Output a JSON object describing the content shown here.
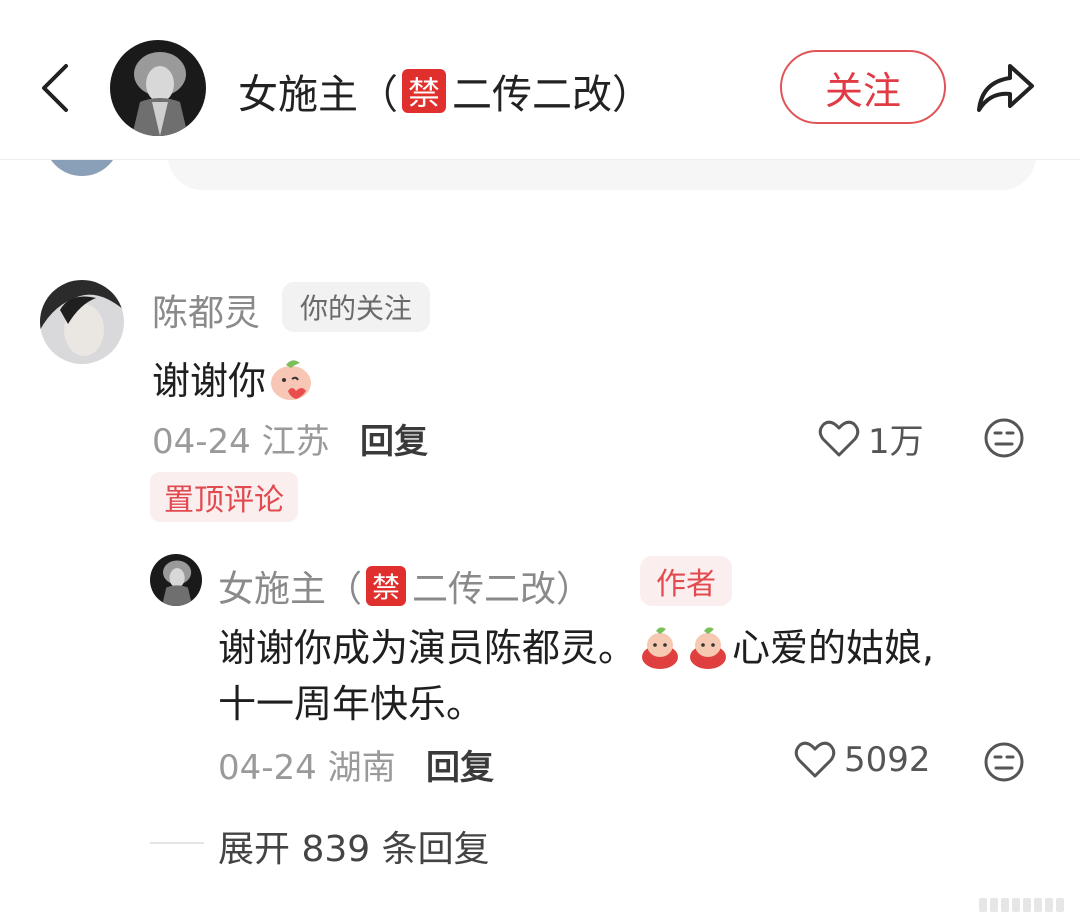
{
  "header": {
    "title_prefix": "女施主（",
    "ban_badge": "禁",
    "title_suffix": "二传二改）",
    "follow_label": "关注"
  },
  "comment": {
    "author": "陈都灵",
    "follow_tag": "你的关注",
    "text": "谢谢你",
    "date": "04-24",
    "location": "江苏",
    "reply_label": "回复",
    "likes": "1万",
    "pin_tag": "置顶评论"
  },
  "reply": {
    "author_prefix": "女施主（",
    "ban_badge": "禁",
    "author_suffix": "二传二改）",
    "author_tag": "作者",
    "text_line1_a": "谢谢你成为演员陈都灵。",
    "text_line1_b": "心爱的姑娘,",
    "text_line2": "十一周年快乐。",
    "date": "04-24",
    "location": "湖南",
    "reply_label": "回复",
    "likes": "5092"
  },
  "expand_label": "展开 839 条回复",
  "colors": {
    "accent": "#e03a45",
    "tag_bg": "#fbeeee",
    "ban_badge": "#e0302e"
  }
}
